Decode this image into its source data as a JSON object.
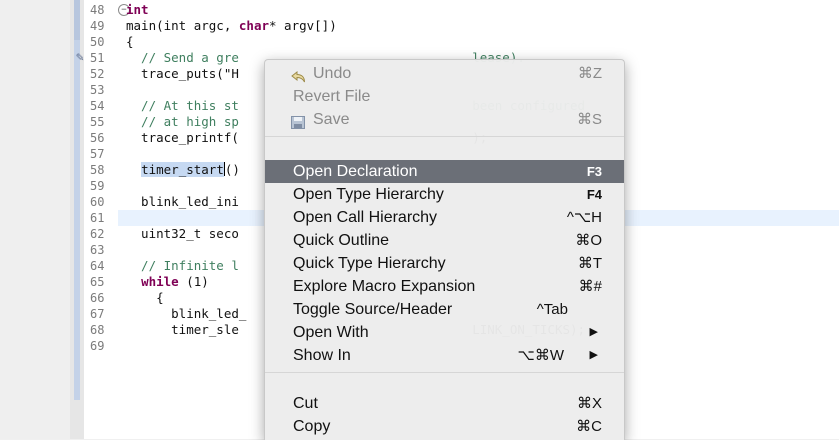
{
  "editor": {
    "line_numbers": [
      "48",
      "49",
      "50",
      "51",
      "52",
      "53",
      "54",
      "55",
      "56",
      "57",
      "58",
      "59",
      "60",
      "61",
      "62",
      "63",
      "64",
      "65",
      "66",
      "67",
      "68",
      "69"
    ],
    "lines": [
      {
        "tokens": [
          {
            "t": "int",
            "c": "kw"
          }
        ]
      },
      {
        "tokens": [
          {
            "t": "main(int argc, ",
            "c": ""
          },
          {
            "t": "char",
            "c": "kw"
          },
          {
            "t": "* argv[])",
            "c": ""
          }
        ]
      },
      {
        "tokens": [
          {
            "t": "{",
            "c": ""
          }
        ]
      },
      {
        "tokens": [
          {
            "t": "  // Send a gre",
            "c": "comment"
          },
          {
            "t": "                               ",
            "c": ""
          },
          {
            "t": "lease).",
            "c": "comment"
          }
        ]
      },
      {
        "tokens": [
          {
            "t": "  trace_puts(\"H",
            "c": ""
          }
        ]
      },
      {
        "tokens": [
          {
            "t": "",
            "c": ""
          }
        ]
      },
      {
        "tokens": [
          {
            "t": "  // At this st",
            "c": "comment"
          },
          {
            "t": "                               ",
            "c": ""
          },
          {
            "t": "been configured",
            "c": "comment"
          }
        ]
      },
      {
        "tokens": [
          {
            "t": "  // at high sp",
            "c": "comment"
          }
        ]
      },
      {
        "tokens": [
          {
            "t": "  trace_printf(",
            "c": ""
          },
          {
            "t": "                               ",
            "c": ""
          },
          {
            "t": ");",
            "c": ""
          }
        ]
      },
      {
        "tokens": [
          {
            "t": "",
            "c": ""
          }
        ]
      },
      {
        "tokens": [
          {
            "t": "  ",
            "c": ""
          },
          {
            "t": "timer_start",
            "c": "sel"
          },
          {
            "t": "()",
            "c": ""
          }
        ]
      },
      {
        "tokens": [
          {
            "t": "",
            "c": ""
          }
        ]
      },
      {
        "tokens": [
          {
            "t": "  blink_led_ini",
            "c": ""
          }
        ]
      },
      {
        "tokens": [
          {
            "t": "",
            "c": ""
          }
        ]
      },
      {
        "tokens": [
          {
            "t": "  uint32_t seco",
            "c": ""
          }
        ]
      },
      {
        "tokens": [
          {
            "t": "",
            "c": ""
          }
        ]
      },
      {
        "tokens": [
          {
            "t": "  // Infinite l",
            "c": "comment"
          }
        ]
      },
      {
        "tokens": [
          {
            "t": "  ",
            "c": ""
          },
          {
            "t": "while",
            "c": "kw"
          },
          {
            "t": " (1)",
            "c": ""
          }
        ]
      },
      {
        "tokens": [
          {
            "t": "    {",
            "c": ""
          }
        ]
      },
      {
        "tokens": [
          {
            "t": "      blink_led_",
            "c": ""
          }
        ]
      },
      {
        "tokens": [
          {
            "t": "      timer_sle",
            "c": ""
          },
          {
            "t": "                               ",
            "c": ""
          },
          {
            "t": "LINK_ON_TICKS);",
            "c": ""
          }
        ]
      },
      {
        "tokens": [
          {
            "t": "",
            "c": ""
          }
        ]
      }
    ]
  },
  "context_menu": {
    "items": [
      {
        "label": "Undo",
        "shortcut": "⌘Z",
        "disabled": true,
        "icon": "undo-icon"
      },
      {
        "label": "Revert File",
        "shortcut": "",
        "disabled": true
      },
      {
        "label": "Save",
        "shortcut": "⌘S",
        "disabled": true,
        "icon": "save-icon"
      },
      {
        "label": "Open Declaration",
        "shortcut": "F3",
        "highlighted": true
      },
      {
        "label": "Open Type Hierarchy",
        "shortcut": "F4"
      },
      {
        "label": "Open Call Hierarchy",
        "shortcut": "^⌥H"
      },
      {
        "label": "Quick Outline",
        "shortcut": "⌘O"
      },
      {
        "label": "Quick Type Hierarchy",
        "shortcut": "⌘T"
      },
      {
        "label": "Explore Macro Expansion",
        "shortcut": "⌘#"
      },
      {
        "label": "Toggle Source/Header",
        "shortcut": "^Tab"
      },
      {
        "label": "Open With",
        "shortcut": "▶"
      },
      {
        "label": "Show In",
        "shortcut": "⌥⌘W"
      },
      {
        "label": "Cut",
        "shortcut": "⌘X"
      },
      {
        "label": "Copy",
        "shortcut": "⌘C"
      }
    ]
  },
  "colors": {
    "keyword": "#7f0055",
    "comment": "#3f7f5f",
    "menu_highlight": "#6b6f77",
    "current_line": "#e8f2fe"
  }
}
